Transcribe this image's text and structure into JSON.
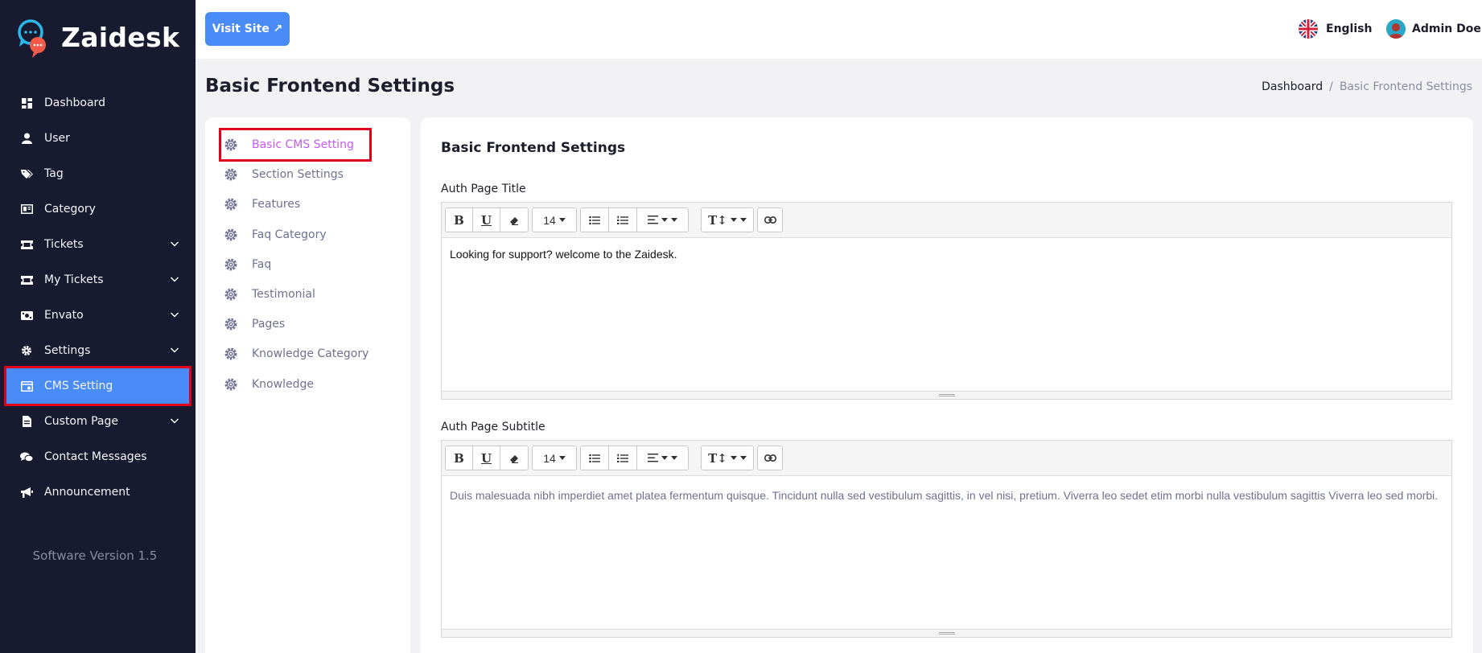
{
  "app": {
    "name": "Zaidesk",
    "version_text": "Software Version 1.5"
  },
  "colors": {
    "sidebar_bg": "#181a2f",
    "accent": "#4a8cf7",
    "active_sub": "#c35cf0",
    "highlight_box": "#e0001b"
  },
  "sidebar": {
    "items": [
      {
        "label": "Dashboard",
        "icon": "dashboard-icon"
      },
      {
        "label": "User",
        "icon": "user-icon"
      },
      {
        "label": "Tag",
        "icon": "tag-icon"
      },
      {
        "label": "Category",
        "icon": "category-icon"
      },
      {
        "label": "Tickets",
        "icon": "ticket-icon",
        "expandable": true
      },
      {
        "label": "My Tickets",
        "icon": "ticket-icon",
        "expandable": true
      },
      {
        "label": "Envato",
        "icon": "envato-icon",
        "expandable": true
      },
      {
        "label": "Settings",
        "icon": "gear-icon",
        "expandable": true
      },
      {
        "label": "CMS Setting",
        "icon": "cms-icon",
        "active": true
      },
      {
        "label": "Custom Page",
        "icon": "page-icon",
        "expandable": true
      },
      {
        "label": "Contact Messages",
        "icon": "chat-icon"
      },
      {
        "label": "Announcement",
        "icon": "megaphone-icon"
      }
    ]
  },
  "header": {
    "visit_site_label": "Visit Site ↗",
    "language_label": "English",
    "user_name": "Admin Doe"
  },
  "page": {
    "title": "Basic Frontend Settings",
    "breadcrumb": {
      "home": "Dashboard",
      "separator": "/",
      "current": "Basic Frontend Settings"
    }
  },
  "cms_menu": {
    "items": [
      {
        "label": "Basic CMS Setting",
        "active": true
      },
      {
        "label": "Section Settings"
      },
      {
        "label": "Features"
      },
      {
        "label": "Faq Category"
      },
      {
        "label": "Faq"
      },
      {
        "label": "Testimonial"
      },
      {
        "label": "Pages"
      },
      {
        "label": "Knowledge Category"
      },
      {
        "label": "Knowledge"
      }
    ]
  },
  "form": {
    "title": "Basic Frontend Settings",
    "auth_title": {
      "label": "Auth Page Title",
      "value": "Looking for support? welcome to the Zaidesk."
    },
    "auth_subtitle": {
      "label": "Auth Page Subtitle",
      "value": "Duis malesuada nibh imperdiet amet platea fermentum quisque. Tincidunt nulla sed vestibulum sagittis, in vel nisi, pretium. Viverra leo sedet etim morbi nulla vestibulum sagittis Viverra leo sed morbi."
    },
    "toolbar": {
      "bold": "B",
      "underline": "U",
      "font_size": "14",
      "text_height": "T↕"
    }
  }
}
